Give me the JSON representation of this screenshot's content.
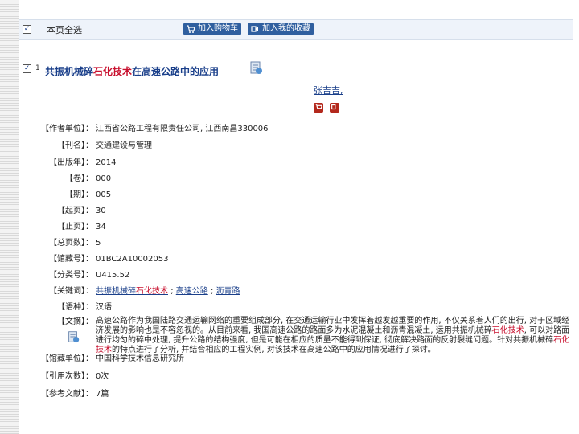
{
  "toolbar": {
    "select_all_label": "本页全选",
    "add_cart_label": "加入购物车",
    "add_favorites_label": "加入我的收藏"
  },
  "result": {
    "index": "1",
    "title_part1": "共振机械碎",
    "title_highlight": "石化技术",
    "title_part2": "在高速公路中的应用",
    "author": "张吉吉,"
  },
  "fields": [
    {
      "label": "【作者单位】：",
      "value": "江西省公路工程有限责任公司, 江西南昌330006"
    },
    {
      "label": "【刊名】：",
      "value": "交通建设与管理"
    },
    {
      "label": "【出版年】：",
      "value": "2014"
    },
    {
      "label": "【卷】：",
      "value": "000"
    },
    {
      "label": "【期】：",
      "value": "005"
    },
    {
      "label": "【起页】：",
      "value": "30"
    },
    {
      "label": "【止页】：",
      "value": "34"
    },
    {
      "label": "【总页数】：",
      "value": "5"
    },
    {
      "label": "【馆藏号】：",
      "value": "01BC2A10002053"
    },
    {
      "label": "【分类号】：",
      "value": "U415.52"
    }
  ],
  "keywords": {
    "label": "【关键词】：",
    "kw1_part1": "共振机械碎",
    "kw1_highlight": "石化技术",
    "kw2": "高速公路",
    "kw3": "沥青路"
  },
  "language": {
    "label": "【语种】：",
    "value": "汉语"
  },
  "abstract": {
    "label": "【文摘】：",
    "part1": "高速公路作为我国陆路交通运输网络的重要组成部分, 在交通运输行业中发挥着越发越重要的作用, 不仅关系着人们的出行, 对于区域经济发展的影响也是不容忽视的。从目前来看, 我国高速公路的路面多为水泥混凝土和沥青混凝土, 运用共振机械碎",
    "hl1": "石化技术",
    "part2": ", 可以对路面进行均匀的碎中处理, 提升公路的结构强度, 但是可能在相应的质量不能得到保证, 彻底解决路面的反射裂缝问题。针对共振机械碎",
    "hl2": "石化技术",
    "part3": "的特点进行了分析, 并结合相应的工程实例, 对该技术在高速公路中的应用情况进行了探讨。"
  },
  "holding": {
    "label": "【馆藏单位】：",
    "value": "中国科学技术信息研究所"
  },
  "cited": {
    "label": "【引用次数】：",
    "value": "0次"
  },
  "refs": {
    "label": "【参考文献】：",
    "value": "7篇"
  },
  "colors": {
    "accent": "#2f5f9f",
    "highlight": "#c8102e",
    "link": "#1a3f8a"
  }
}
